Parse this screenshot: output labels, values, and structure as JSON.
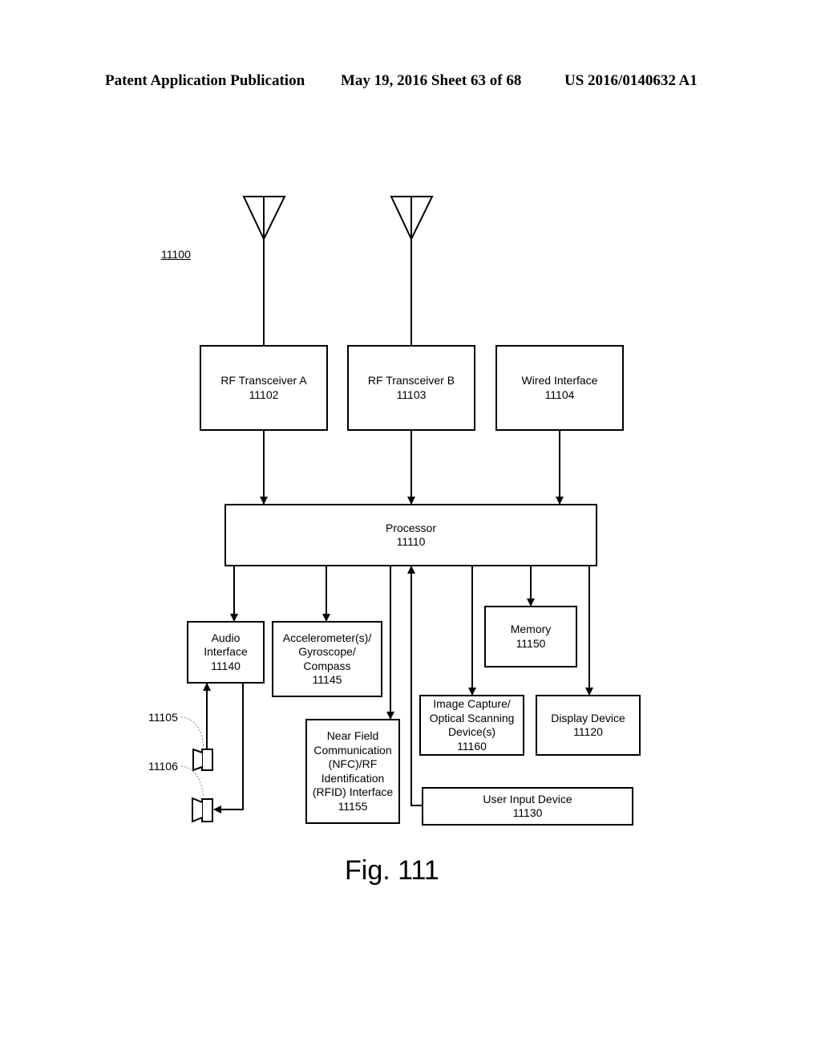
{
  "header": {
    "left": "Patent Application Publication",
    "date_sheet": "May 19, 2016  Sheet 63 of 68",
    "patent_number": "US 2016/0140632 A1"
  },
  "figure_ref": "11100",
  "figure_label": "Fig. 111",
  "blocks": {
    "rf_a": {
      "name": "RF Transceiver A",
      "ref": "11102"
    },
    "rf_b": {
      "name": "RF Transceiver B",
      "ref": "11103"
    },
    "wired": {
      "name": "Wired Interface",
      "ref": "11104"
    },
    "processor": {
      "name": "Processor",
      "ref": "11110"
    },
    "audio": {
      "lines": [
        "Audio",
        "Interface"
      ],
      "ref": "11140"
    },
    "accel": {
      "lines": [
        "Accelerometer(s)/",
        "Gyroscope/",
        "Compass"
      ],
      "ref": "11145"
    },
    "memory": {
      "name": "Memory",
      "ref": "11150"
    },
    "image": {
      "lines": [
        "Image Capture/",
        "Optical Scanning",
        "Device(s)"
      ],
      "ref": "11160"
    },
    "display": {
      "name": "Display Device",
      "ref": "11120"
    },
    "nfc": {
      "lines": [
        "Near Field",
        "Communication",
        "(NFC)/RF",
        "Identification",
        "(RFID) Interface"
      ],
      "ref": "11155"
    },
    "user_input": {
      "name": "User Input Device",
      "ref": "11130"
    }
  },
  "speaker_refs": {
    "mic": "11105",
    "speaker": "11106"
  }
}
